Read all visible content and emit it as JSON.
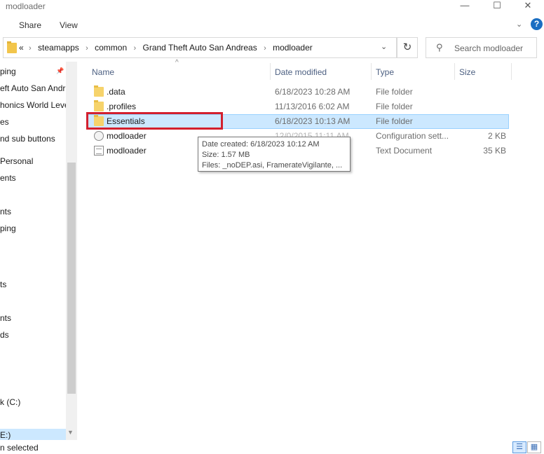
{
  "window": {
    "title": "modloader",
    "minimize_glyph": "—",
    "maximize_glyph": "☐",
    "close_glyph": "✕"
  },
  "ribbon": {
    "tabs": [
      "Share",
      "View"
    ],
    "expand_glyph": "⌄",
    "help_glyph": "?"
  },
  "address": {
    "overflow": "«",
    "crumbs": [
      "steamapps",
      "common",
      "Grand Theft Auto San Andreas",
      "modloader"
    ],
    "separator": "›",
    "dropdown_glyph": "⌄",
    "refresh_glyph": "↻"
  },
  "search": {
    "placeholder": "Search modloader",
    "icon": "search-icon",
    "glyph": "⚲"
  },
  "nav": {
    "items": [
      {
        "label": "ping"
      },
      {
        "label": "eft Auto San Andr"
      },
      {
        "label": "honics World Leve"
      },
      {
        "label": "es"
      },
      {
        "label": "nd sub buttons"
      },
      {
        "label": " Personal"
      },
      {
        "label": "ents"
      },
      {
        "label": "nts"
      },
      {
        "label": "ping"
      },
      {
        "label": "ts"
      },
      {
        "label": "nts"
      },
      {
        "label": "ds"
      },
      {
        "label": "k (C:)"
      },
      {
        "label": "E:)"
      }
    ],
    "pin_glyph": "📌",
    "scroll_down_glyph": "▼"
  },
  "columns": {
    "name": "Name",
    "date": "Date modified",
    "type": "Type",
    "size": "Size",
    "sort_glyph": "^"
  },
  "files": [
    {
      "name": ".data",
      "date": "6/18/2023 10:28 AM",
      "type": "File folder",
      "size": "",
      "icon": "folder-icon"
    },
    {
      "name": ".profiles",
      "date": "11/13/2016 6:02 AM",
      "type": "File folder",
      "size": "",
      "icon": "folder-icon"
    },
    {
      "name": "Essentials",
      "date": "6/18/2023 10:13 AM",
      "type": "File folder",
      "size": "",
      "icon": "folder-icon"
    },
    {
      "name": "modloader",
      "date": "12/0/2015 11:11 AM",
      "type": "Configuration sett...",
      "size": "2 KB",
      "icon": "config-file-icon"
    },
    {
      "name": "modloader",
      "date": "",
      "type": "Text Document",
      "size": "35 KB",
      "icon": "text-file-icon"
    }
  ],
  "tooltip": {
    "created": "Date created: 6/18/2023 10:12 AM",
    "size": "Size: 1.57 MB",
    "files": "Files: _noDEP.asi, FramerateVigilante, ..."
  },
  "status": {
    "text": "n selected"
  },
  "colors": {
    "selection": "#cce8ff",
    "highlight_box": "#d3202e",
    "folder": "#f6d36b"
  }
}
